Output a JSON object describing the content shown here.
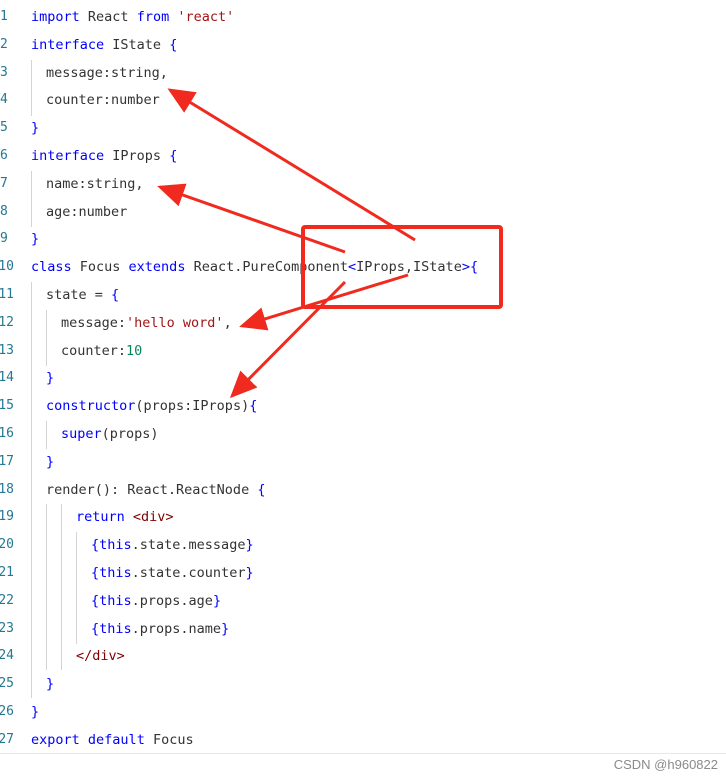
{
  "code": {
    "lines": [
      {
        "num": "1",
        "tokens": [
          [
            "kw",
            "import"
          ],
          [
            "plain",
            " React "
          ],
          [
            "kw",
            "from"
          ],
          [
            "plain",
            " "
          ],
          [
            "str",
            "'react'"
          ]
        ]
      },
      {
        "num": "2",
        "tokens": [
          [
            "kw",
            "interface"
          ],
          [
            "plain",
            " IState "
          ],
          [
            "brace",
            "{"
          ]
        ]
      },
      {
        "num": "3",
        "tokens": [
          [
            "plain",
            "message:string,"
          ]
        ]
      },
      {
        "num": "4",
        "tokens": [
          [
            "plain",
            "counter:number"
          ]
        ]
      },
      {
        "num": "5",
        "tokens": [
          [
            "brace",
            "}"
          ]
        ]
      },
      {
        "num": "6",
        "tokens": [
          [
            "kw",
            "interface"
          ],
          [
            "plain",
            " IProps "
          ],
          [
            "brace",
            "{"
          ]
        ]
      },
      {
        "num": "7",
        "tokens": [
          [
            "plain",
            "name:string,"
          ]
        ]
      },
      {
        "num": "8",
        "tokens": [
          [
            "plain",
            "age:number"
          ]
        ]
      },
      {
        "num": "9",
        "tokens": [
          [
            "brace",
            "}"
          ]
        ]
      },
      {
        "num": "10",
        "tokens": [
          [
            "kw",
            "class"
          ],
          [
            "plain",
            " Focus "
          ],
          [
            "kw",
            "extends"
          ],
          [
            "plain",
            " React.PureComponent"
          ],
          [
            "brace",
            "<"
          ],
          [
            "plain",
            "IProps,IState"
          ],
          [
            "brace",
            ">{"
          ]
        ]
      },
      {
        "num": "11",
        "tokens": [
          [
            "plain",
            "state = "
          ],
          [
            "brace",
            "{"
          ]
        ]
      },
      {
        "num": "12",
        "tokens": [
          [
            "plain",
            "message:"
          ],
          [
            "str",
            "'hello word'"
          ],
          [
            "plain",
            ","
          ]
        ]
      },
      {
        "num": "13",
        "tokens": [
          [
            "plain",
            "counter:"
          ],
          [
            "num",
            "10"
          ]
        ]
      },
      {
        "num": "14",
        "tokens": [
          [
            "brace",
            "}"
          ]
        ]
      },
      {
        "num": "15",
        "tokens": [
          [
            "kw",
            "constructor"
          ],
          [
            "plain",
            "(props:IProps)"
          ],
          [
            "brace",
            "{"
          ]
        ]
      },
      {
        "num": "16",
        "tokens": [
          [
            "kw",
            "super"
          ],
          [
            "plain",
            "(props)"
          ]
        ]
      },
      {
        "num": "17",
        "tokens": [
          [
            "brace",
            "}"
          ]
        ]
      },
      {
        "num": "18",
        "tokens": [
          [
            "plain",
            "render(): React.ReactNode "
          ],
          [
            "brace",
            "{"
          ]
        ]
      },
      {
        "num": "19",
        "tokens": [
          [
            "kw",
            "return"
          ],
          [
            "plain",
            " "
          ],
          [
            "tag",
            "<div>"
          ]
        ]
      },
      {
        "num": "20",
        "tokens": [
          [
            "brace",
            "{"
          ],
          [
            "kw",
            "this"
          ],
          [
            "plain",
            ".state.message"
          ],
          [
            "brace",
            "}"
          ]
        ]
      },
      {
        "num": "21",
        "tokens": [
          [
            "brace",
            "{"
          ],
          [
            "kw",
            "this"
          ],
          [
            "plain",
            ".state.counter"
          ],
          [
            "brace",
            "}"
          ]
        ]
      },
      {
        "num": "22",
        "tokens": [
          [
            "brace",
            "{"
          ],
          [
            "kw",
            "this"
          ],
          [
            "plain",
            ".props.age"
          ],
          [
            "brace",
            "}"
          ]
        ]
      },
      {
        "num": "23",
        "tokens": [
          [
            "brace",
            "{"
          ],
          [
            "kw",
            "this"
          ],
          [
            "plain",
            ".props.name"
          ],
          [
            "brace",
            "}"
          ]
        ]
      },
      {
        "num": "24",
        "tokens": [
          [
            "tag",
            "</div>"
          ]
        ]
      },
      {
        "num": "25",
        "tokens": [
          [
            "brace",
            "}"
          ]
        ]
      },
      {
        "num": "26",
        "tokens": [
          [
            "brace",
            "}"
          ]
        ]
      },
      {
        "num": "27",
        "tokens": [
          [
            "kw",
            "export"
          ],
          [
            "plain",
            " "
          ],
          [
            "kw",
            "default"
          ],
          [
            "plain",
            " Focus"
          ]
        ]
      }
    ]
  },
  "watermark": "CSDN @h960822",
  "colors": {
    "annotation_red": "#f02a1e",
    "keyword": "#0000ff",
    "string": "#a31515",
    "number": "#098658",
    "line_number": "#237893"
  },
  "icons": {
    "annotation": "red-arrow"
  }
}
